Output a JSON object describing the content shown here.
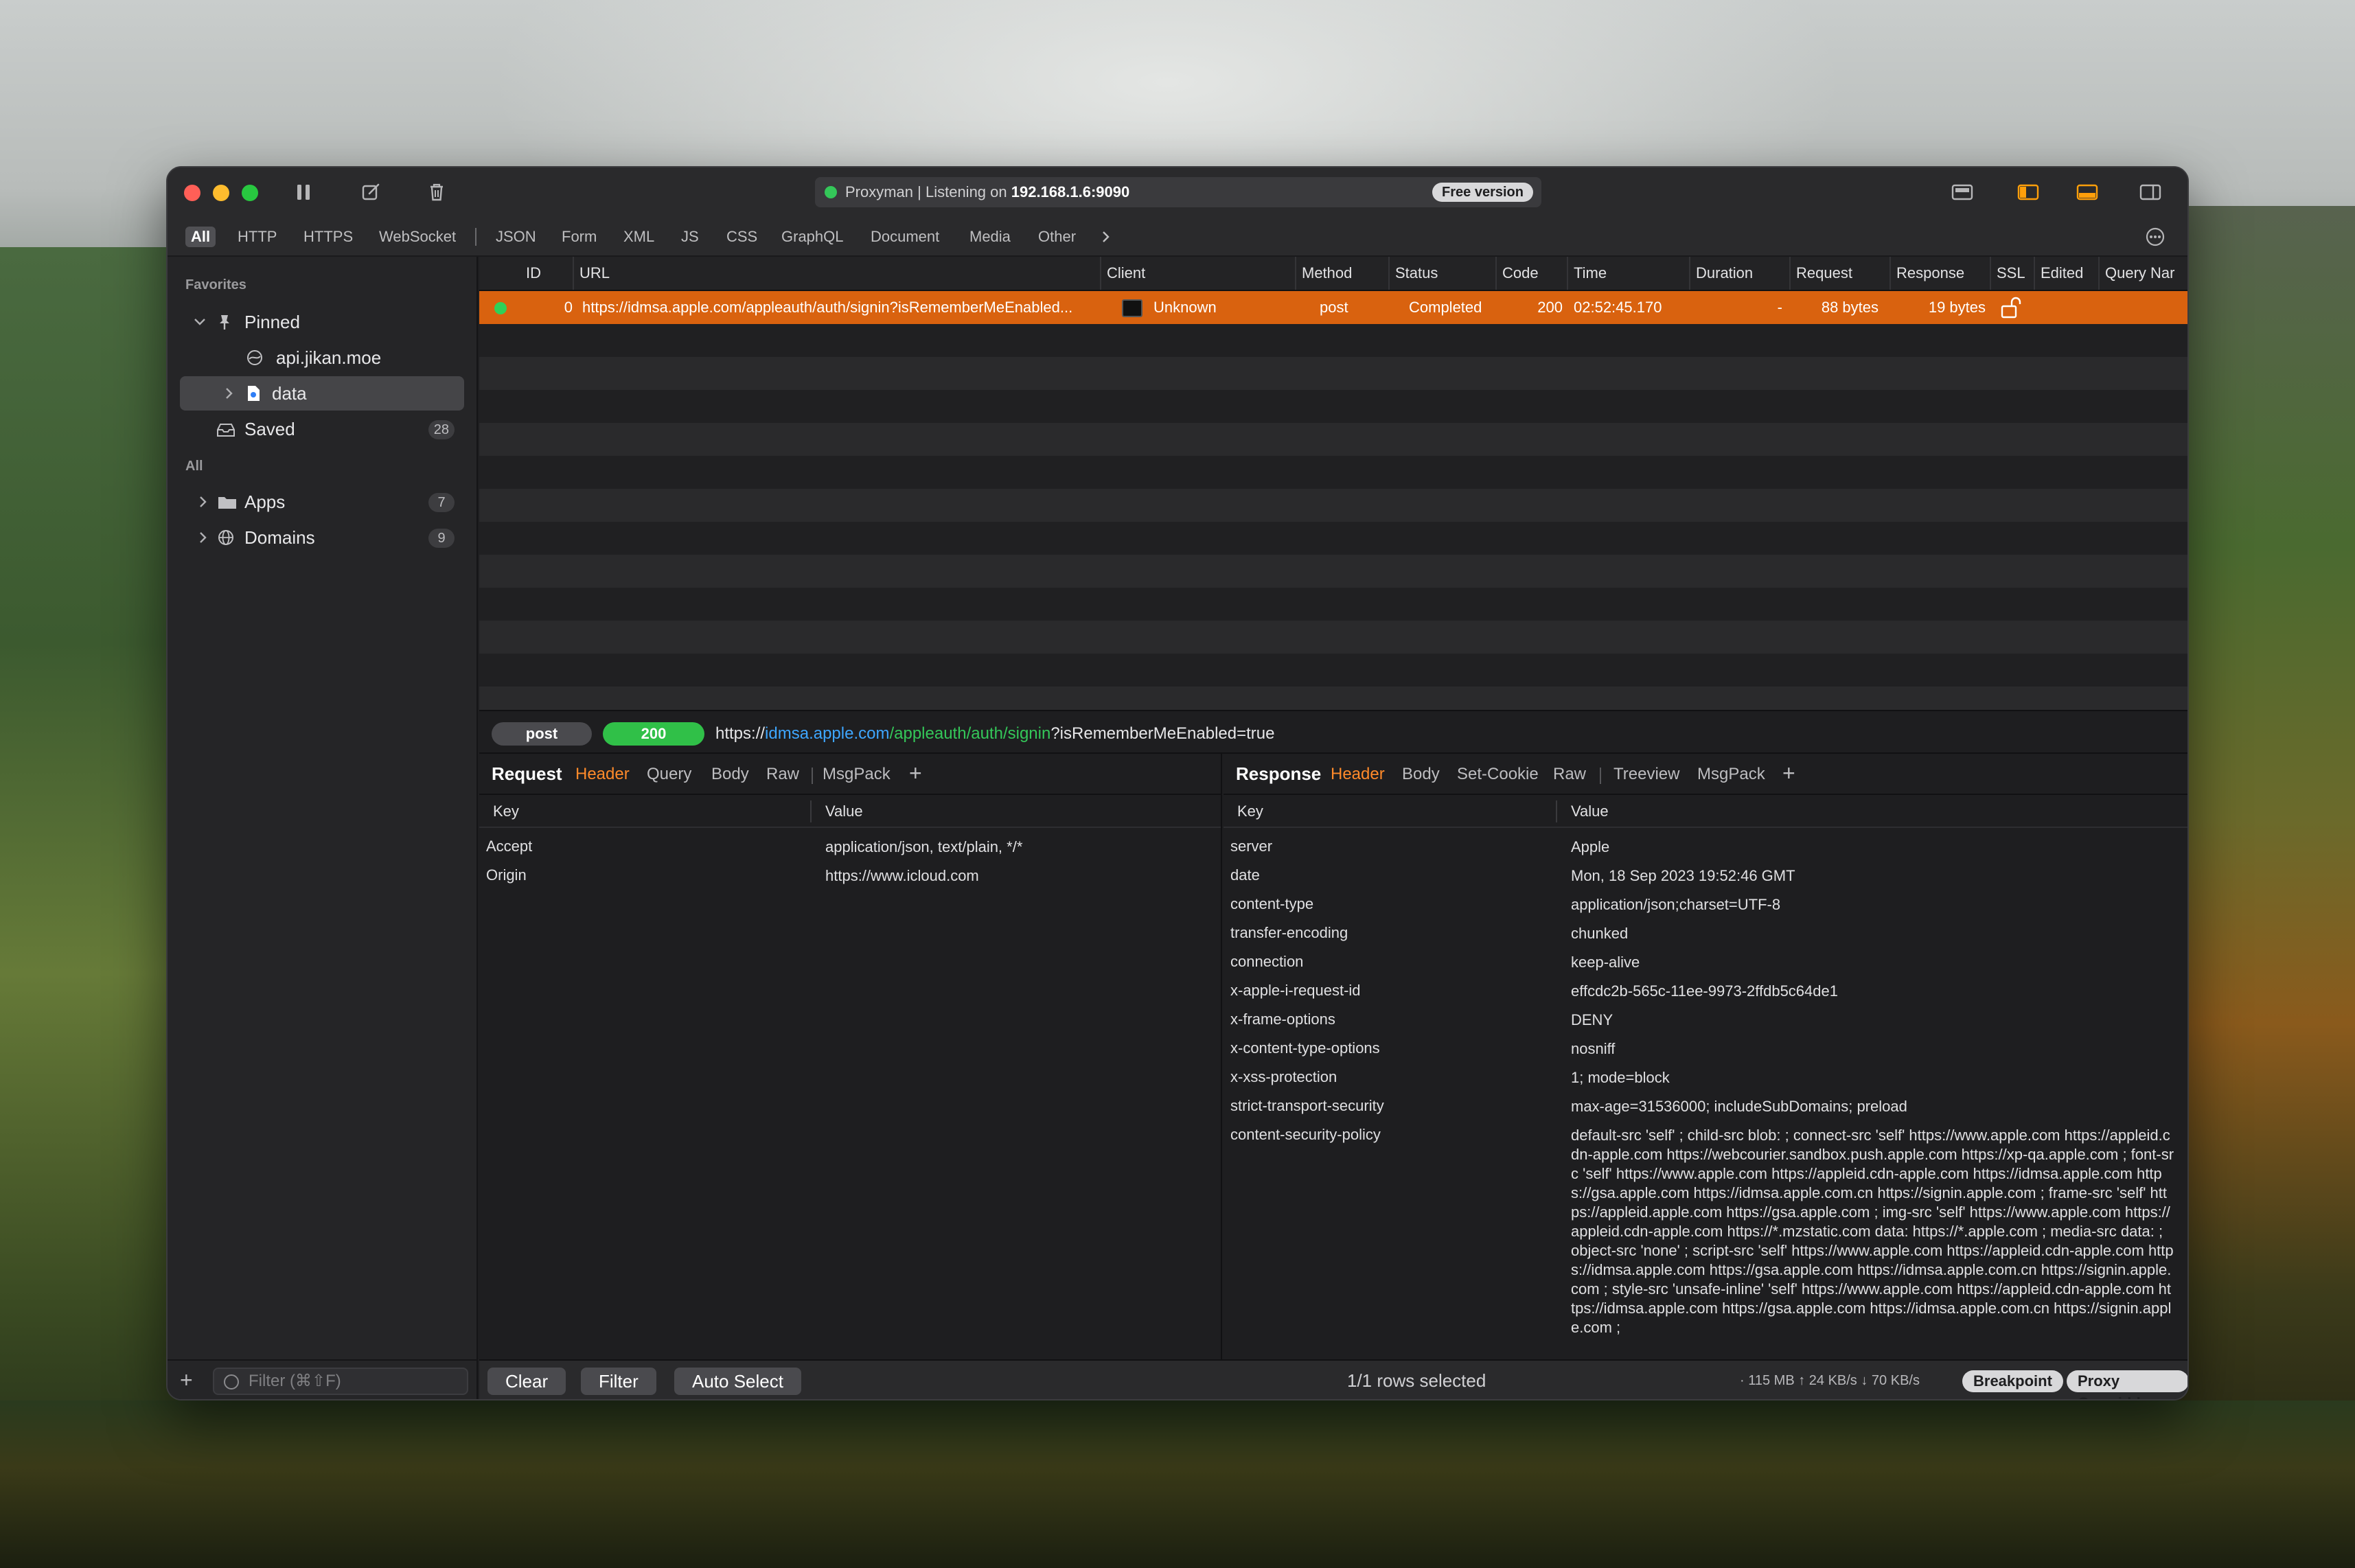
{
  "titlebar": {
    "status_prefix": "Proxyman | Listening on ",
    "status_address": "192.168.1.6:9090",
    "free_badge": "Free version"
  },
  "filters": [
    "All",
    "HTTP",
    "HTTPS",
    "WebSocket",
    "JSON",
    "Form",
    "XML",
    "JS",
    "CSS",
    "GraphQL",
    "Document",
    "Media",
    "Other"
  ],
  "sidebar": {
    "favorites_label": "Favorites",
    "pinned_label": "Pinned",
    "pinned_item_1": "api.jikan.moe",
    "pinned_item_2": "data",
    "saved_label": "Saved",
    "saved_count": "28",
    "all_label": "All",
    "apps_label": "Apps",
    "apps_count": "7",
    "domains_label": "Domains",
    "domains_count": "9",
    "filter_placeholder": "Filter (⌘⇧F)"
  },
  "table": {
    "columns": [
      "ID",
      "URL",
      "Client",
      "Method",
      "Status",
      "Code",
      "Time",
      "Duration",
      "Request",
      "Response",
      "SSL",
      "Edited",
      "Query Nar"
    ],
    "row": {
      "id": "0",
      "url": "https://idmsa.apple.com/appleauth/auth/signin?isRememberMeEnabled...",
      "client": "Unknown",
      "method": "post",
      "status": "Completed",
      "code": "200",
      "time": "02:52:45.170",
      "duration": "-",
      "request": "88 bytes",
      "response": "19 bytes"
    }
  },
  "urlbar": {
    "method": "post",
    "code": "200",
    "scheme": "https://",
    "host": "idmsa.apple.com",
    "path": "/appleauth/auth/signin",
    "query": "?isRememberMeEnabled=true"
  },
  "request": {
    "title": "Request",
    "tabs": [
      "Header",
      "Query",
      "Body",
      "Raw",
      "MsgPack"
    ],
    "key_header": "Key",
    "value_header": "Value",
    "rows": [
      {
        "k": "Accept",
        "v": "application/json, text/plain, */*"
      },
      {
        "k": "Origin",
        "v": "https://www.icloud.com"
      }
    ]
  },
  "response": {
    "title": "Response",
    "tabs": [
      "Header",
      "Body",
      "Set-Cookie",
      "Raw",
      "Treeview",
      "MsgPack"
    ],
    "key_header": "Key",
    "value_header": "Value",
    "rows": [
      {
        "k": "server",
        "v": "Apple"
      },
      {
        "k": "date",
        "v": "Mon, 18 Sep 2023 19:52:46 GMT"
      },
      {
        "k": "content-type",
        "v": "application/json;charset=UTF-8"
      },
      {
        "k": "transfer-encoding",
        "v": "chunked"
      },
      {
        "k": "connection",
        "v": "keep-alive"
      },
      {
        "k": "x-apple-i-request-id",
        "v": "effcdc2b-565c-11ee-9973-2ffdb5c64de1"
      },
      {
        "k": "x-frame-options",
        "v": "DENY"
      },
      {
        "k": "x-content-type-options",
        "v": "nosniff"
      },
      {
        "k": "x-xss-protection",
        "v": "1; mode=block"
      },
      {
        "k": "strict-transport-security",
        "v": "max-age=31536000; includeSubDomains; preload"
      },
      {
        "k": "content-security-policy",
        "v": "default-src 'self' ; child-src blob: ; connect-src 'self' https://www.apple.com https://appleid.cdn-apple.com https://webcourier.sandbox.push.apple.com https://xp-qa.apple.com ; font-src 'self' https://www.apple.com https://appleid.cdn-apple.com https://idmsa.apple.com https://gsa.apple.com https://idmsa.apple.com.cn https://signin.apple.com ; frame-src 'self' https://appleid.apple.com https://gsa.apple.com ; img-src 'self' https://www.apple.com https://appleid.cdn-apple.com https://*.mzstatic.com data: https://*.apple.com ; media-src data: ; object-src 'none' ; script-src 'self' https://www.apple.com https://appleid.cdn-apple.com https://idmsa.apple.com https://gsa.apple.com https://idmsa.apple.com.cn https://signin.apple.com ; style-src 'unsafe-inline' 'self' https://www.apple.com https://appleid.cdn-apple.com https://idmsa.apple.com https://gsa.apple.com https://idmsa.apple.com.cn https://signin.apple.com ;"
      }
    ]
  },
  "bottombar": {
    "clear": "Clear",
    "filter": "Filter",
    "auto_select": "Auto Select",
    "rows_selected": "1/1 rows selected",
    "stats": "· 115 MB ↑ 24 KB/s ↓ 70 KB/s",
    "breakpoint": "Breakpoint",
    "proxy_overridden": "Proxy Overridden"
  }
}
